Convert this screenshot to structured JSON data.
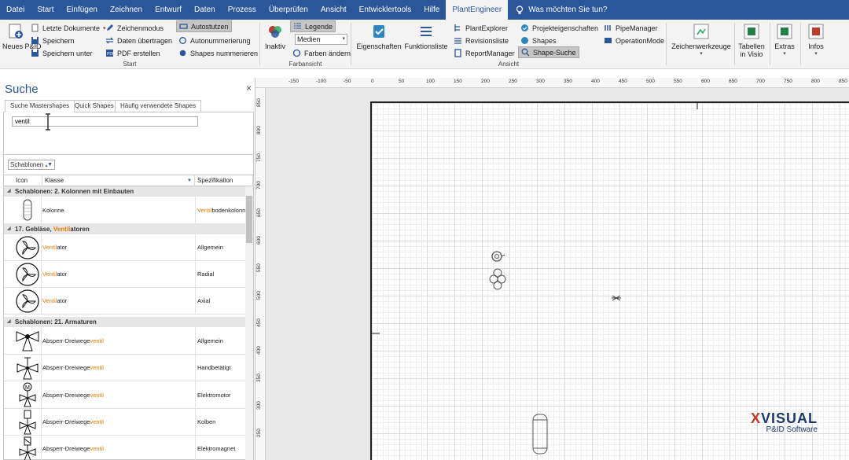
{
  "menu": {
    "tabs": [
      {
        "label": "Datei"
      },
      {
        "label": "Start"
      },
      {
        "label": "Einfügen"
      },
      {
        "label": "Zeichnen"
      },
      {
        "label": "Entwurf"
      },
      {
        "label": "Daten"
      },
      {
        "label": "Prozess"
      },
      {
        "label": "Überprüfen"
      },
      {
        "label": "Ansicht"
      },
      {
        "label": "Entwicklertools"
      },
      {
        "label": "Hilfe"
      },
      {
        "label": "PlantEngineer"
      }
    ],
    "active_tab": "PlantEngineer",
    "tell_me": "Was möchten Sie tun?"
  },
  "ribbon": {
    "start": {
      "group_label": "Start",
      "new_pid": "Neues P&ID",
      "recent_docs": "Letzte Dokumente",
      "save": "Speichern",
      "save_as": "Speichern unter",
      "draw_mode": "Zeichenmodus",
      "transfer_data": "Daten übertragen",
      "pdf": "PDF erstellen",
      "autostutzen": "Autostutzen",
      "autonumbering": "Autonummerierung",
      "number_shapes": "Shapes nummerieren"
    },
    "color": {
      "group_label": "Farbansicht",
      "inactive": "Inaktiv",
      "legend": "Legende",
      "media_select": "Medien",
      "change_colors": "Farben ändern"
    },
    "view": {
      "group_label": "Ansicht",
      "properties": "Eigenschaften",
      "function_list": "Funktionsliste",
      "plantexplorer": "PlantExplorer",
      "revision_list": "Revisionsliste",
      "report_manager": "ReportManager",
      "project_props": "Projekteigenschaften",
      "shapes": "Shapes",
      "shape_search": "Shape-Suche",
      "pipe_manager": "PipeManager",
      "operation_mode": "OperationMode"
    },
    "tools": {
      "drawing_tools": "Zeichenwerkzeuge",
      "tables_visio_1": "Tabellen",
      "tables_visio_2": "in Visio",
      "extras": "Extras",
      "infos": "Infos"
    }
  },
  "pane": {
    "title": "Suche",
    "close": "×",
    "tabs": [
      {
        "label": "Suche Mastershapes"
      },
      {
        "label": "Quick Shapes"
      },
      {
        "label": "Häufig verwendete Shapes"
      }
    ],
    "search_value": "ventil",
    "group_select": "Schablonen",
    "columns": {
      "icon": "Icon",
      "class": "Klasse",
      "spec": "Spezifikation"
    },
    "results": [
      {
        "group": "Schablonen: 2. Kolonnen mit Einbauten",
        "rows": [
          {
            "cls_pre": "Kolonne",
            "cls_hl": "",
            "cls_post": "",
            "spec_hl": "Ventil",
            "spec_post": "bodenkolonne",
            "icon": "column-icon"
          }
        ]
      },
      {
        "group_pre": "17. Gebläse, ",
        "group_hl": "Ventil",
        "group_post": "atoren",
        "rows": [
          {
            "cls_pre": "",
            "cls_hl": "Ventil",
            "cls_post": "ator",
            "spec": "Allgemein",
            "icon": "fan-icon"
          },
          {
            "cls_pre": "",
            "cls_hl": "Ventil",
            "cls_post": "ator",
            "spec": "Radial",
            "icon": "fan-icon"
          },
          {
            "cls_pre": "",
            "cls_hl": "Ventil",
            "cls_post": "ator",
            "spec": "Axial",
            "icon": "fan-icon"
          }
        ]
      },
      {
        "group": "Schablonen: 21. Armaturen",
        "rows": [
          {
            "cls_pre": "Absperr-Dreiwege",
            "cls_hl": "ventil",
            "spec": "Allgemein",
            "icon": "three-way-valve-icon"
          },
          {
            "cls_pre": "Absperr-Dreiwege",
            "cls_hl": "ventil",
            "spec": "Handbetätigt",
            "icon": "three-way-valve-manual-icon"
          },
          {
            "cls_pre": "Absperr-Dreiwege",
            "cls_hl": "ventil",
            "spec": "Elektromotor",
            "icon": "three-way-valve-motor-icon"
          },
          {
            "cls_pre": "Absperr-Dreiwege",
            "cls_hl": "ventil",
            "spec": "Kolben",
            "icon": "three-way-valve-piston-icon"
          },
          {
            "cls_pre": "Absperr-Dreiwege",
            "cls_hl": "ventil",
            "spec": "Elektromagnet",
            "icon": "three-way-valve-solenoid-icon"
          }
        ]
      }
    ]
  },
  "ruler": {
    "h_ticks": [
      "-150",
      "-100",
      "-50",
      "0",
      "50",
      "100",
      "150",
      "200",
      "250",
      "300",
      "350",
      "400",
      "450",
      "500",
      "550",
      "600",
      "650",
      "700",
      "750",
      "800",
      "850"
    ],
    "v_ticks": [
      "850",
      "800",
      "750",
      "700",
      "650",
      "600",
      "550",
      "500",
      "450",
      "400",
      "350",
      "300",
      "250"
    ]
  },
  "logo": {
    "main_x": "X",
    "main": "VISUAL",
    "sub": "P&ID Software"
  },
  "colors": {
    "accent": "#2b579a",
    "highlight": "#e67e00",
    "logo": "#1b3a6b"
  }
}
